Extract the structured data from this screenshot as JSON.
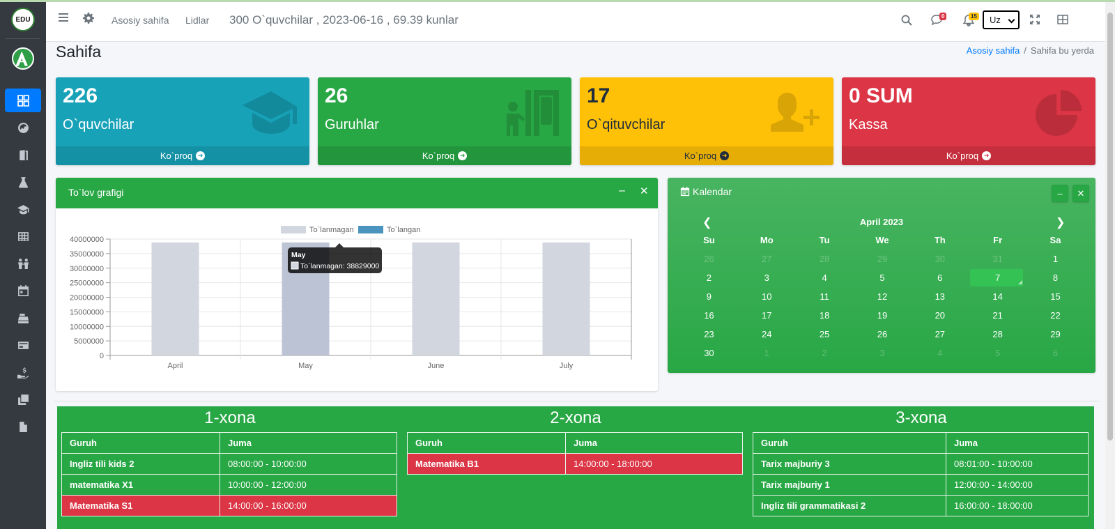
{
  "app": {
    "logo_text": "EDU"
  },
  "header": {
    "nav_home": "Asosiy sahifa",
    "nav_leads": "Lidlar",
    "info": "300 O`quvchilar , 2023-06-16 , 69.39 kunlar",
    "messages_badge": "0",
    "notifications_badge": "15",
    "language_selected": "Uz"
  },
  "page": {
    "title": "Sahifa",
    "breadcrumb_home": "Asosiy sahifa",
    "breadcrumb_current": "Sahifa bu yerda"
  },
  "stats": [
    {
      "value": "226",
      "label": "O`quvchilar",
      "more": "Ko`proq",
      "color": "#17a2b8"
    },
    {
      "value": "26",
      "label": "Guruhlar",
      "more": "Ko`proq",
      "color": "#28a745"
    },
    {
      "value": "17",
      "label": "O`qituvchilar",
      "more": "Ko`proq",
      "color": "#ffc107"
    },
    {
      "value": "0 SUM",
      "label": "Kassa",
      "more": "Ko`proq",
      "color": "#dc3545"
    }
  ],
  "chart_card": {
    "title": "To`lov grafigi",
    "tooltip_title": "May",
    "tooltip_text": "To`lanmagan: 38829000"
  },
  "chart_data": {
    "type": "bar",
    "categories": [
      "April",
      "May",
      "June",
      "July"
    ],
    "series": [
      {
        "name": "To`lanmagan",
        "values": [
          38829000,
          38829000,
          38829000,
          38829000
        ],
        "color": "#d2d6de"
      },
      {
        "name": "To`langan",
        "values": [
          0,
          0,
          0,
          0
        ],
        "color": "#4b94c0"
      }
    ],
    "y_ticks": [
      0,
      5000000,
      10000000,
      15000000,
      20000000,
      25000000,
      30000000,
      35000000,
      40000000
    ],
    "ylim": [
      0,
      40000000
    ],
    "legend_position": "top",
    "grid": true
  },
  "calendar": {
    "title": "Kalendar",
    "month": "April 2023",
    "weekdays": [
      "Su",
      "Mo",
      "Tu",
      "We",
      "Th",
      "Fr",
      "Sa"
    ],
    "weeks": [
      [
        {
          "d": "26",
          "m": true
        },
        {
          "d": "27",
          "m": true
        },
        {
          "d": "28",
          "m": true
        },
        {
          "d": "29",
          "m": true
        },
        {
          "d": "30",
          "m": true
        },
        {
          "d": "31",
          "m": true
        },
        {
          "d": "1"
        }
      ],
      [
        {
          "d": "2"
        },
        {
          "d": "3"
        },
        {
          "d": "4"
        },
        {
          "d": "5"
        },
        {
          "d": "6"
        },
        {
          "d": "7",
          "t": true
        },
        {
          "d": "8"
        }
      ],
      [
        {
          "d": "9"
        },
        {
          "d": "10"
        },
        {
          "d": "11"
        },
        {
          "d": "12"
        },
        {
          "d": "13"
        },
        {
          "d": "14"
        },
        {
          "d": "15"
        }
      ],
      [
        {
          "d": "16"
        },
        {
          "d": "17"
        },
        {
          "d": "18"
        },
        {
          "d": "19"
        },
        {
          "d": "20"
        },
        {
          "d": "21"
        },
        {
          "d": "22"
        }
      ],
      [
        {
          "d": "23"
        },
        {
          "d": "24"
        },
        {
          "d": "25"
        },
        {
          "d": "26"
        },
        {
          "d": "27"
        },
        {
          "d": "28"
        },
        {
          "d": "29"
        }
      ],
      [
        {
          "d": "30"
        },
        {
          "d": "1",
          "m": true
        },
        {
          "d": "2",
          "m": true
        },
        {
          "d": "3",
          "m": true
        },
        {
          "d": "4",
          "m": true
        },
        {
          "d": "5",
          "m": true
        },
        {
          "d": "6",
          "m": true
        }
      ]
    ]
  },
  "rooms": [
    {
      "title": "1-xona",
      "col_group": "Guruh",
      "col_day": "Juma",
      "rows": [
        {
          "group": "Ingliz tili kids 2",
          "time": "08:00:00 - 10:00:00",
          "danger": false
        },
        {
          "group": "matematika X1",
          "time": "10:00:00 - 12:00:00",
          "danger": false
        },
        {
          "group": "Matematika S1",
          "time": "14:00:00 - 16:00:00",
          "danger": true
        }
      ]
    },
    {
      "title": "2-xona",
      "col_group": "Guruh",
      "col_day": "Juma",
      "rows": [
        {
          "group": "Matematika B1",
          "time": "14:00:00 - 18:00:00",
          "danger": true
        }
      ]
    },
    {
      "title": "3-xona",
      "col_group": "Guruh",
      "col_day": "Juma",
      "rows": [
        {
          "group": "Tarix majburiy 3",
          "time": "08:01:00 - 10:00:00",
          "danger": false
        },
        {
          "group": "Tarix majburiy 1",
          "time": "12:00:00 - 14:00:00",
          "danger": false
        },
        {
          "group": "Ingliz tili grammatikasi 2",
          "time": "16:00:00 - 18:00:00",
          "danger": false
        }
      ]
    }
  ],
  "colors": {
    "primary": "#007bff",
    "success": "#28a745",
    "danger": "#dc3545",
    "sidebar": "#343a40"
  }
}
